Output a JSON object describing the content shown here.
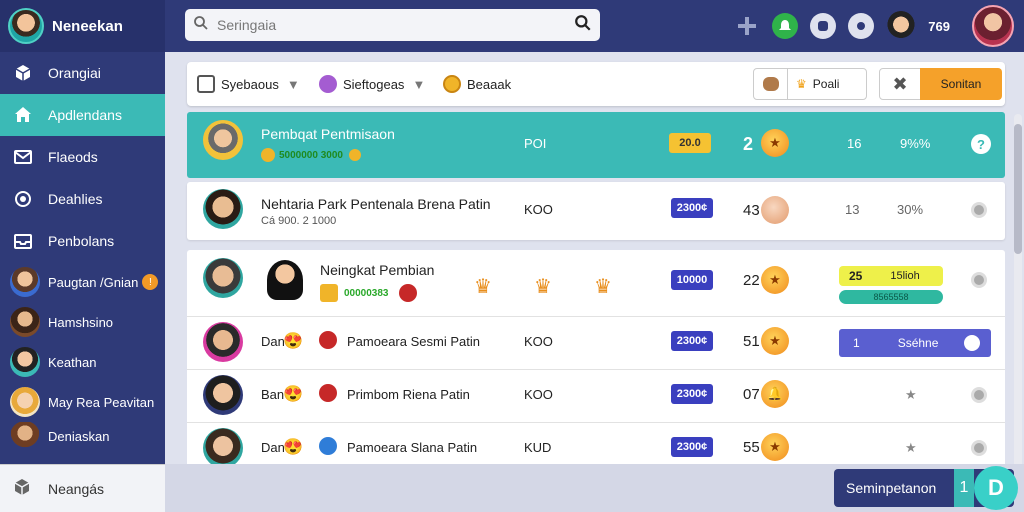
{
  "app": {
    "name": "Neneekan"
  },
  "search": {
    "placeholder": "Seringaia"
  },
  "topbar": {
    "coins": "769"
  },
  "sidebar": {
    "items": [
      {
        "label": "Orangiai",
        "icon": "cube-icon"
      },
      {
        "label": "Apdlendans",
        "icon": "home-icon",
        "active": true
      },
      {
        "label": "Flaeods",
        "icon": "mail-icon"
      },
      {
        "label": "Deahlies",
        "icon": "eye-icon"
      },
      {
        "label": "Penbolans",
        "icon": "inbox-icon"
      }
    ],
    "users": [
      {
        "label": "Paugtan /Gnian",
        "badge": "!"
      },
      {
        "label": "Hamshsino"
      },
      {
        "label": "Keathan"
      },
      {
        "label": "May Rea Peavitan"
      },
      {
        "label": "Deniaskan"
      }
    ],
    "bottom": {
      "label": "Neangás",
      "icon": "box-icon"
    }
  },
  "toolbar": {
    "filter1": "Syebaous",
    "filter2": "Sieftogeas",
    "filter3": "Beaaak",
    "pool_label": "Poali",
    "action_label": "Sonitan"
  },
  "rows": [
    {
      "name": "Pembqat Pentmisaon",
      "sub": "5000000 3000",
      "col1": "POI",
      "pill": "20.0",
      "rank": "2",
      "n": "16",
      "pct": "9%%"
    },
    {
      "name": "Nehtaria Park Pentenala Brena Patin",
      "sub": "Cá 900. 2 1000",
      "col1": "KOO",
      "pill": "2300¢",
      "rank": "43",
      "n": "13",
      "pct": "30%"
    },
    {
      "name": "Neingkat Pembian",
      "sub": "00000383",
      "col1": "",
      "pill": "10000",
      "rank": "22",
      "tag1": "25",
      "tag2": "15lioh",
      "tag3": "8565558"
    },
    {
      "short": "Dan",
      "name": "Pamoeara Sesmi Patin",
      "col1": "KOO",
      "pill": "2300¢",
      "rank": "51",
      "progress_value": "1",
      "progress_label": "Sséhne"
    },
    {
      "short": "Ban",
      "name": "Primbom Riena Patin",
      "col1": "KOO",
      "pill": "2300¢",
      "rank": "07"
    },
    {
      "short": "Dan",
      "name": "Pamoeara Slana Patin",
      "col1": "KUD",
      "pill": "2300¢",
      "rank": "55"
    }
  ],
  "bottom_action": {
    "label": "Seminpetanon",
    "count": "1",
    "chip": "D"
  }
}
